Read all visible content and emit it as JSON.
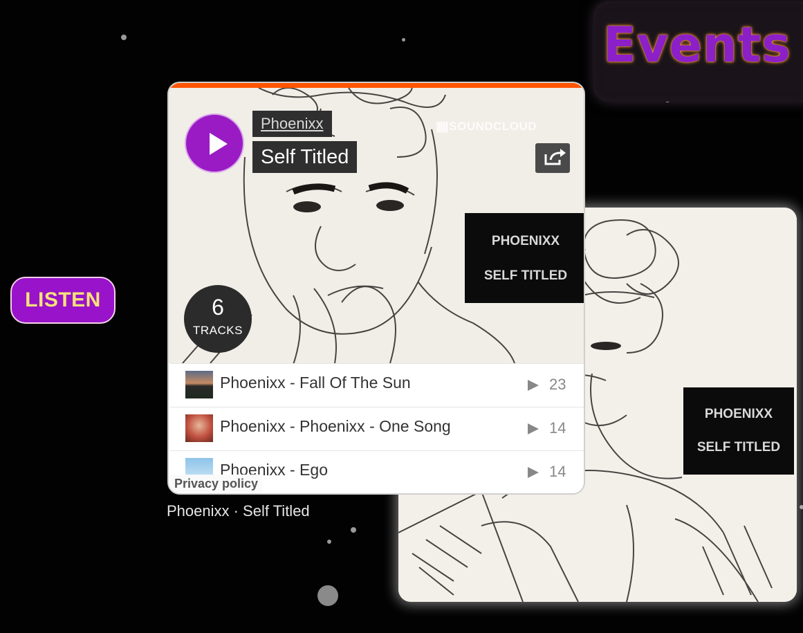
{
  "header": {
    "events_title": "Events"
  },
  "listen_button": {
    "label": "LISTEN"
  },
  "player": {
    "artist": "Phoenixx",
    "title": "Self Titled",
    "brand": "SOUNDCLOUD",
    "tracks_count": "6",
    "tracks_label": "TRACKS",
    "privacy_label": "Privacy policy",
    "tracks": [
      {
        "title": "Phoenixx - Fall Of The Sun",
        "plays": "23"
      },
      {
        "title": "Phoenixx - Phoenixx - One Song",
        "plays": "14"
      },
      {
        "title": "Phoenixx - Ego",
        "plays": "14"
      }
    ]
  },
  "cover_art": {
    "line1": "PHOENIXX",
    "line2": "SELF TITLED"
  },
  "caption": "Phoenixx · Self Titled",
  "colors": {
    "accent_purple": "#9a1bc4",
    "soundcloud_orange": "#ff5500",
    "events_glow": "#ff9a2a",
    "listen_text": "#f7e27a"
  }
}
